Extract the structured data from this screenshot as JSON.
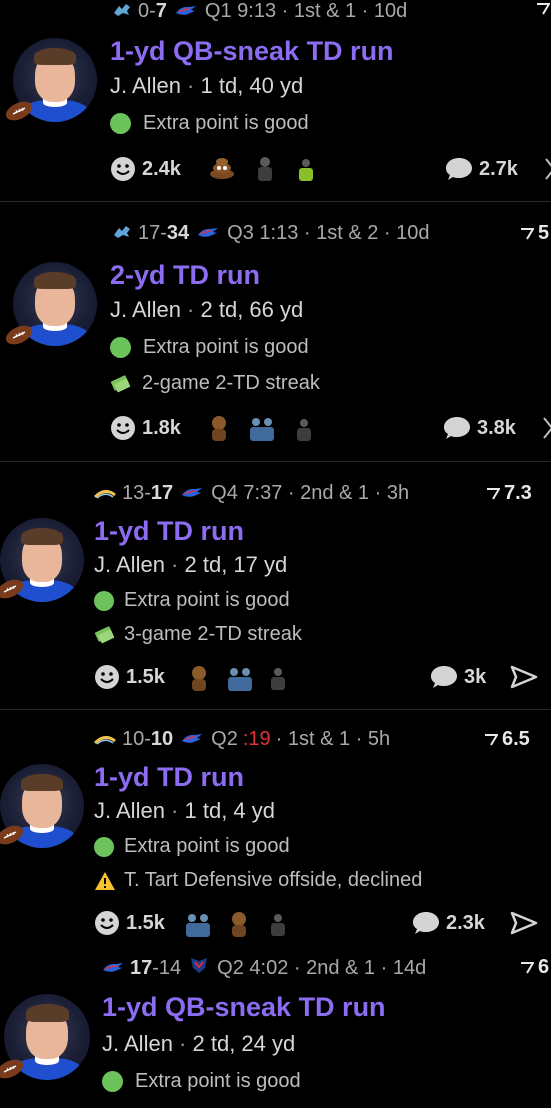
{
  "plays": [
    {
      "away_score": "0",
      "home_score": "7",
      "situation": "Q1 9:13 · 1st & 1 · 10d",
      "title": "1-yd QB-sneak TD run",
      "player": "J. Allen",
      "player_stats": "1 td, 40 yd",
      "notes": [
        "Extra point is good"
      ],
      "likes": "2.4k",
      "comments": "2.7k"
    },
    {
      "away_score": "17",
      "home_score": "34",
      "situation": "Q3 1:13 · 1st & 2 · 10d",
      "odds": "5",
      "title": "2-yd TD run",
      "player": "J. Allen",
      "player_stats": "2 td, 66 yd",
      "notes": [
        "Extra point is good",
        "2-game 2-TD streak"
      ],
      "likes": "1.8k",
      "comments": "3.8k"
    },
    {
      "away_score": "13",
      "home_score": "17",
      "situation": "Q4 7:37 · 2nd & 1 · 3h",
      "odds": "7.3",
      "title": "1-yd TD run",
      "player": "J. Allen",
      "player_stats": "2 td, 17 yd",
      "notes": [
        "Extra point is good",
        "3-game 2-TD streak"
      ],
      "likes": "1.5k",
      "comments": "3k"
    },
    {
      "away_score": "10",
      "home_score": "10",
      "situation_q": "Q2",
      "situation_clock": ":19",
      "situation_rest": "· 1st & 1 · 5h",
      "odds": "6.5",
      "title": "1-yd TD run",
      "player": "J. Allen",
      "player_stats": "1 td, 4 yd",
      "notes": [
        "Extra point is good",
        "T. Tart Defensive offside, declined"
      ],
      "likes": "1.5k",
      "comments": "2.3k"
    },
    {
      "away_score": "17",
      "home_score": "14",
      "situation": "Q2 4:02 · 2nd & 1 · 14d",
      "odds": "6",
      "title": "1-yd QB-sneak TD run",
      "player": "J. Allen",
      "player_stats": "2 td, 24 yd",
      "notes": [
        "Extra point is good"
      ]
    }
  ],
  "colors": {
    "title": "#8c6cf0",
    "good_dot": "#6cc25b",
    "clock_red": "#e0333a",
    "bills_blue": "#1f4fcf"
  },
  "icons": {
    "team_logos": [
      "lions-logo",
      "bills-logo",
      "chargers-logo",
      "texans-logo"
    ],
    "reaction": "smiley-icon",
    "comment": "comment-bubble-icon",
    "share": "send-arrow-icon",
    "odds": "odds-arrow-icon",
    "streak": "money-icon",
    "warning": "warning-icon"
  }
}
